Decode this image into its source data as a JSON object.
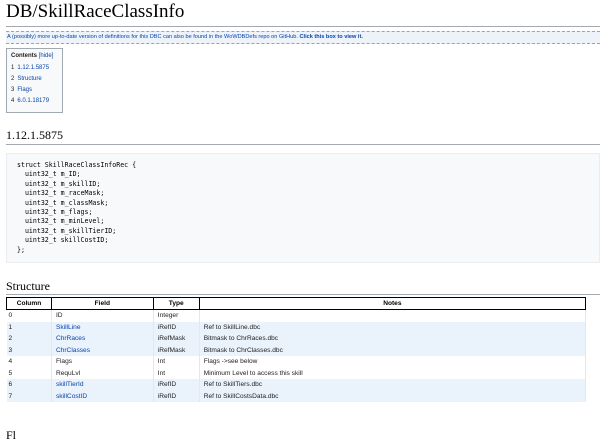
{
  "page": {
    "title": "DB/SkillRaceClassInfo"
  },
  "notice": {
    "text": "A (possibly) more up-to-date version of definitions for this DBC can also be found in the WoWDBDefs repo on GitHub.",
    "action": "Click this box to view it."
  },
  "toc": {
    "title": "Contents",
    "hide_label": "[hide]",
    "items": [
      {
        "num": "1",
        "label": "1.12.1.5875"
      },
      {
        "num": "2",
        "label": "Structure"
      },
      {
        "num": "3",
        "label": "Flags"
      },
      {
        "num": "4",
        "label": "6.0.1.18179"
      }
    ]
  },
  "sections": {
    "version_heading": "1.12.1.5875",
    "structure_heading": "Structure",
    "next_heading_partial": "Fl"
  },
  "code": "struct SkillRaceClassInfoRec {\n  uint32_t m_ID;\n  uint32_t m_skillID;\n  uint32_t m_raceMask;\n  uint32_t m_classMask;\n  uint32_t m_flags;\n  uint32_t m_minLevel;\n  uint32_t m_skillTierID;\n  uint32_t skillCostID;\n};",
  "table": {
    "headers": [
      "Column",
      "Field",
      "Type",
      "Notes"
    ],
    "rows": [
      {
        "col": "0",
        "field": "ID",
        "field_link": false,
        "type": "Integer",
        "notes": ""
      },
      {
        "col": "1",
        "field": "SkillLine",
        "field_link": true,
        "type": "iRefID",
        "notes": "Ref to SkillLine.dbc"
      },
      {
        "col": "2",
        "field": "ChrRaces",
        "field_link": true,
        "type": "iRefMask",
        "notes": "Bitmask to ChrRaces.dbc"
      },
      {
        "col": "3",
        "field": "ChrClasses",
        "field_link": true,
        "type": "iRefMask",
        "notes": "Bitmask to ChrClasses.dbc"
      },
      {
        "col": "4",
        "field": "Flags",
        "field_link": false,
        "type": "Int",
        "notes": "Flags ->see below"
      },
      {
        "col": "5",
        "field": "RequLvl",
        "field_link": false,
        "type": "Int",
        "notes": "Minimum Level to access this skill"
      },
      {
        "col": "6",
        "field": "skillTierId",
        "field_link": true,
        "type": "iRefID",
        "notes": "Ref to SkillTiers.dbc"
      },
      {
        "col": "7",
        "field": "skillCostID",
        "field_link": true,
        "type": "iRefID",
        "notes": "Ref to SkillCostsData.dbc"
      }
    ]
  },
  "colors": {
    "link": "#0645ad",
    "row_shade": "#eaf2fb",
    "notice_bg": "#eef3fa"
  }
}
